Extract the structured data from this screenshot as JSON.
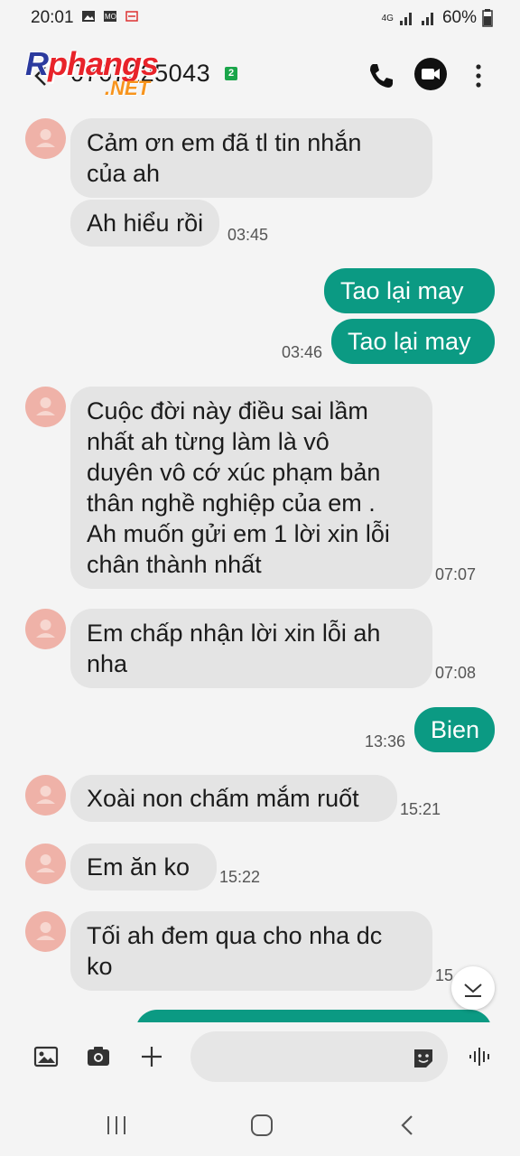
{
  "status_bar": {
    "time": "20:01",
    "network": "4G",
    "battery": "60%"
  },
  "header": {
    "contact": "0767225043",
    "sim_badge": "2",
    "watermark_main": "Rphangs",
    "watermark_sub": ".NET"
  },
  "messages": [
    {
      "dir": "in",
      "text_lines": [
        "Cảm ơn em đã tl tin nhắn",
        "của ah"
      ],
      "time": ""
    },
    {
      "dir": "in",
      "text_lines": [
        "Ah hiểu rồi"
      ],
      "time": "03:45"
    },
    {
      "dir": "out",
      "text_lines": [
        "Tao lại may"
      ],
      "time": ""
    },
    {
      "dir": "out",
      "text_lines": [
        "Tao lại may"
      ],
      "time": "03:46"
    },
    {
      "dir": "in",
      "text_lines": [
        "Cuộc đời này điều sai lầm",
        "nhất ah từng làm là vô",
        "duyên vô cớ xúc phạm bản",
        "thân nghề nghiệp của em .",
        "Ah muốn gửi em 1 lời xin lỗi",
        "chân thành nhất"
      ],
      "time": "07:07"
    },
    {
      "dir": "in",
      "text_lines": [
        "Em chấp nhận lời xin lỗi ah",
        "nha"
      ],
      "time": "07:08"
    },
    {
      "dir": "out",
      "text_lines": [
        "Bien"
      ],
      "time": "13:36"
    },
    {
      "dir": "in",
      "text_lines": [
        "Xoài non chấm mắm ruốt"
      ],
      "time": "15:21"
    },
    {
      "dir": "in",
      "text_lines": [
        "Em ăn ko"
      ],
      "time": "15:22"
    },
    {
      "dir": "in",
      "text_lines": [
        "Tối ah đem qua cho nha dc",
        "ko"
      ],
      "time": "15"
    }
  ],
  "input": {
    "placeholder": ""
  },
  "colors": {
    "outgoing_bubble": "#0b9a83",
    "incoming_bubble": "#e4e4e4",
    "avatar": "#efb2a8",
    "background": "#f4f4f4"
  },
  "icons": [
    "back-icon",
    "phone-icon",
    "video-call-icon",
    "more-options-icon",
    "gallery-icon",
    "camera-icon",
    "add-icon",
    "sticker-icon",
    "voice-icon",
    "scroll-down-icon",
    "recent-apps-icon",
    "home-icon",
    "nav-back-icon"
  ]
}
